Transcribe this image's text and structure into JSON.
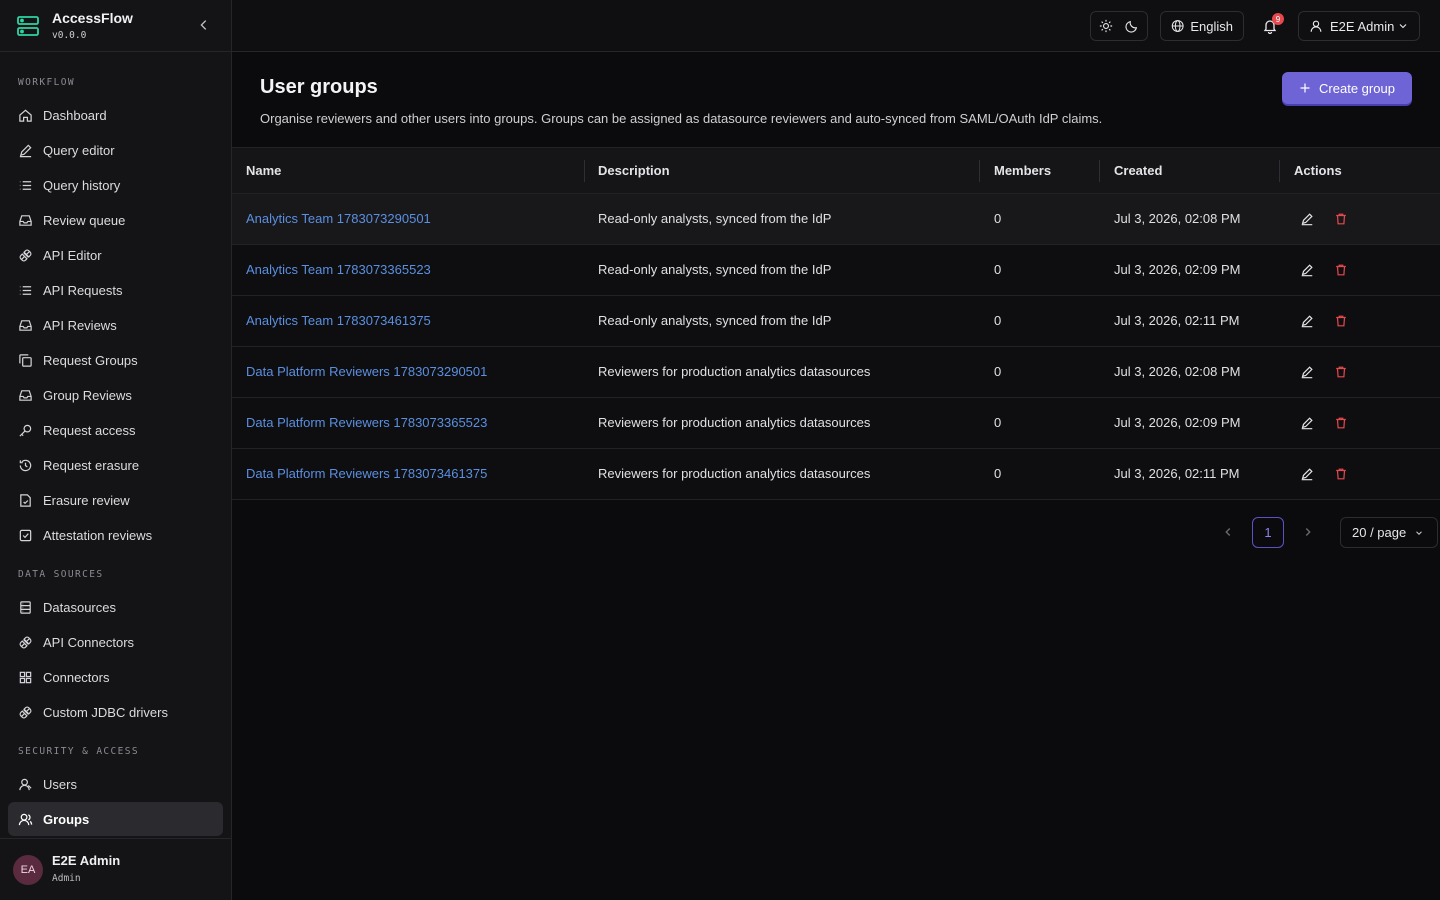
{
  "app": {
    "name": "AccessFlow",
    "version": "v0.0.0"
  },
  "sidebar": {
    "sections": [
      {
        "label": "WORKFLOW",
        "items": [
          {
            "label": "Dashboard",
            "icon": "home-icon"
          },
          {
            "label": "Query editor",
            "icon": "edit-icon"
          },
          {
            "label": "Query history",
            "icon": "list-icon"
          },
          {
            "label": "Review queue",
            "icon": "inbox-icon"
          },
          {
            "label": "API Editor",
            "icon": "plug-icon"
          },
          {
            "label": "API Requests",
            "icon": "list-icon"
          },
          {
            "label": "API Reviews",
            "icon": "inbox-icon"
          },
          {
            "label": "Request Groups",
            "icon": "copy-icon"
          },
          {
            "label": "Group Reviews",
            "icon": "inbox-icon"
          },
          {
            "label": "Request access",
            "icon": "key-icon"
          },
          {
            "label": "Request erasure",
            "icon": "history-icon"
          },
          {
            "label": "Erasure review",
            "icon": "file-check-icon"
          },
          {
            "label": "Attestation reviews",
            "icon": "checkbox-icon"
          }
        ]
      },
      {
        "label": "DATA SOURCES",
        "items": [
          {
            "label": "Datasources",
            "icon": "database-icon"
          },
          {
            "label": "API Connectors",
            "icon": "plug-icon"
          },
          {
            "label": "Connectors",
            "icon": "grid-icon"
          },
          {
            "label": "Custom JDBC drivers",
            "icon": "plug-icon"
          }
        ]
      },
      {
        "label": "SECURITY & ACCESS",
        "items": [
          {
            "label": "Users",
            "icon": "user-icon"
          },
          {
            "label": "Groups",
            "icon": "users-icon",
            "active": true
          }
        ]
      }
    ],
    "user": {
      "initials": "EA",
      "name": "E2E Admin",
      "role": "Admin"
    }
  },
  "topbar": {
    "language": "English",
    "notifications_count": "9",
    "user_name": "E2E Admin"
  },
  "page": {
    "title": "User groups",
    "description": "Organise reviewers and other users into groups. Groups can be assigned as datasource reviewers and auto-synced from SAML/OAuth IdP claims.",
    "create_label": "Create group"
  },
  "table": {
    "columns": [
      "Name",
      "Description",
      "Members",
      "Created",
      "Actions"
    ],
    "rows": [
      {
        "name": "Analytics Team 1783073290501",
        "description": "Read-only analysts, synced from the IdP",
        "members": "0",
        "created": "Jul 3, 2026, 02:08 PM"
      },
      {
        "name": "Analytics Team 1783073365523",
        "description": "Read-only analysts, synced from the IdP",
        "members": "0",
        "created": "Jul 3, 2026, 02:09 PM"
      },
      {
        "name": "Analytics Team 1783073461375",
        "description": "Read-only analysts, synced from the IdP",
        "members": "0",
        "created": "Jul 3, 2026, 02:11 PM"
      },
      {
        "name": "Data Platform Reviewers 1783073290501",
        "description": "Reviewers for production analytics datasources",
        "members": "0",
        "created": "Jul 3, 2026, 02:08 PM"
      },
      {
        "name": "Data Platform Reviewers 1783073365523",
        "description": "Reviewers for production analytics datasources",
        "members": "0",
        "created": "Jul 3, 2026, 02:09 PM"
      },
      {
        "name": "Data Platform Reviewers 1783073461375",
        "description": "Reviewers for production analytics datasources",
        "members": "0",
        "created": "Jul 3, 2026, 02:11 PM"
      }
    ]
  },
  "pagination": {
    "current_page": "1",
    "page_size": "20 / page"
  },
  "colors": {
    "accent": "#6e64d6",
    "link": "#5b8fe0",
    "danger": "#e5484d"
  }
}
